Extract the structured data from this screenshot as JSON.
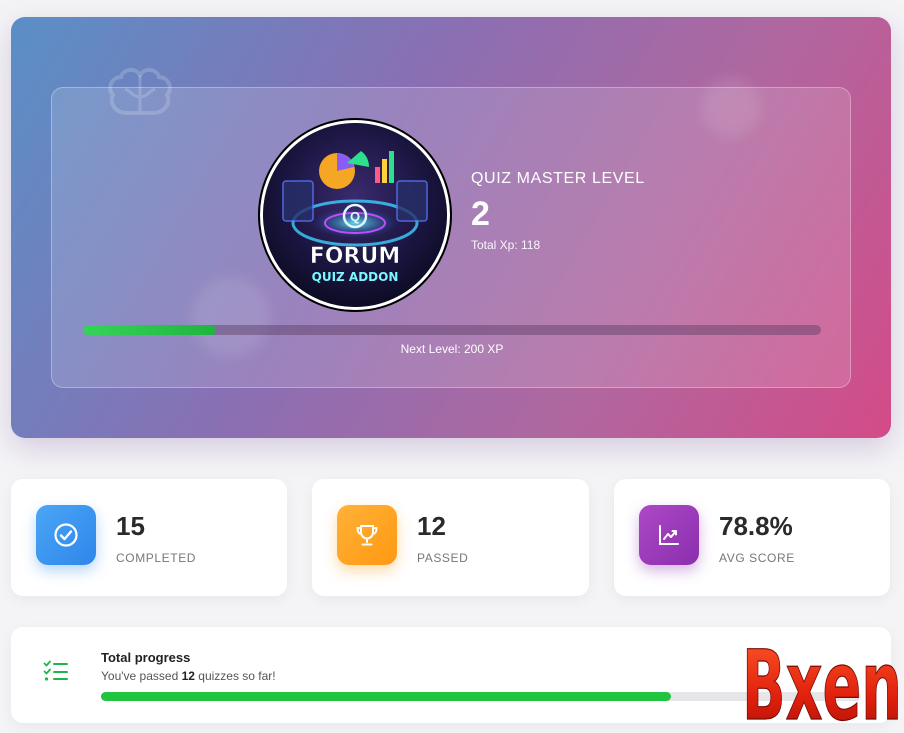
{
  "hero": {
    "level_title": "QUIZ MASTER LEVEL",
    "level_number": "2",
    "total_xp": "Total Xp: 118",
    "xp_progress": 0.18,
    "next_level": "Next Level: 200 XP",
    "avatar": {
      "line1": "FORUM",
      "line2": "QUIZ ADDON",
      "badge_letter": "Q"
    }
  },
  "stats": [
    {
      "value": "15",
      "label": "COMPLETED",
      "icon": "check-circle-icon",
      "color": "#3a94f0"
    },
    {
      "value": "12",
      "label": "PASSED",
      "icon": "trophy-icon",
      "color": "#ffa21f"
    },
    {
      "value": "78.8%",
      "label": "AVG SCORE",
      "icon": "chart-line-icon",
      "color": "#9b3ab8"
    }
  ],
  "total_progress": {
    "title": "Total progress",
    "sub_prefix": "You've passed ",
    "sub_count": "12",
    "sub_suffix": " quizzes so far!",
    "progress": 0.75,
    "icon": "list-check-icon"
  },
  "watermark": {
    "text": "Bxen"
  }
}
